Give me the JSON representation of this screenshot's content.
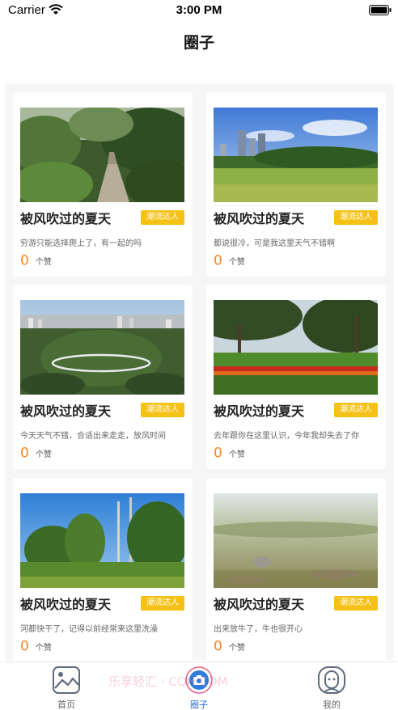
{
  "status_bar": {
    "carrier": "Carrier",
    "time": "3:00 PM"
  },
  "page": {
    "title": "圈子"
  },
  "posts": [
    {
      "title": "被风吹过的夏天",
      "badge": "潮流达人",
      "desc": "穷游只能选择爬上了，有一起的吗",
      "likes": "0",
      "like_unit": "个赞",
      "image": "mountain-path"
    },
    {
      "title": "被风吹过的夏天",
      "badge": "潮流达人",
      "desc": "都说很冷，可是我这里天气不错啊",
      "likes": "0",
      "like_unit": "个赞",
      "image": "city-lawn"
    },
    {
      "title": "被风吹过的夏天",
      "badge": "潮流达人",
      "desc": "今天天气不错，合适出来走走，放风时间",
      "likes": "0",
      "like_unit": "个赞",
      "image": "aerial-park"
    },
    {
      "title": "被风吹过的夏天",
      "badge": "潮流达人",
      "desc": "去年跟你在这里认识，今年我却失去了你",
      "likes": "0",
      "like_unit": "个赞",
      "image": "flower-park"
    },
    {
      "title": "被风吹过的夏天",
      "badge": "潮流达人",
      "desc": "河都快干了，记得以前经常来这里洗澡",
      "likes": "0",
      "like_unit": "个赞",
      "image": "riverside-trees"
    },
    {
      "title": "被风吹过的夏天",
      "badge": "潮流达人",
      "desc": "出来放牛了，牛也很开心",
      "likes": "0",
      "like_unit": "个赞",
      "image": "grass-field"
    }
  ],
  "tab_bar": {
    "items": [
      {
        "label": "首页",
        "icon": "image-icon",
        "active": false
      },
      {
        "label": "圈子",
        "icon": "camera-icon",
        "active": true
      },
      {
        "label": "我的",
        "icon": "profile-icon",
        "active": false
      }
    ],
    "active_color": "#2b6fd8"
  },
  "watermark": "乐享轻汇 · CQH.COM",
  "colors": {
    "badge": "#f5c116",
    "likes": "#f5872a",
    "background": "#f6f6f6"
  }
}
